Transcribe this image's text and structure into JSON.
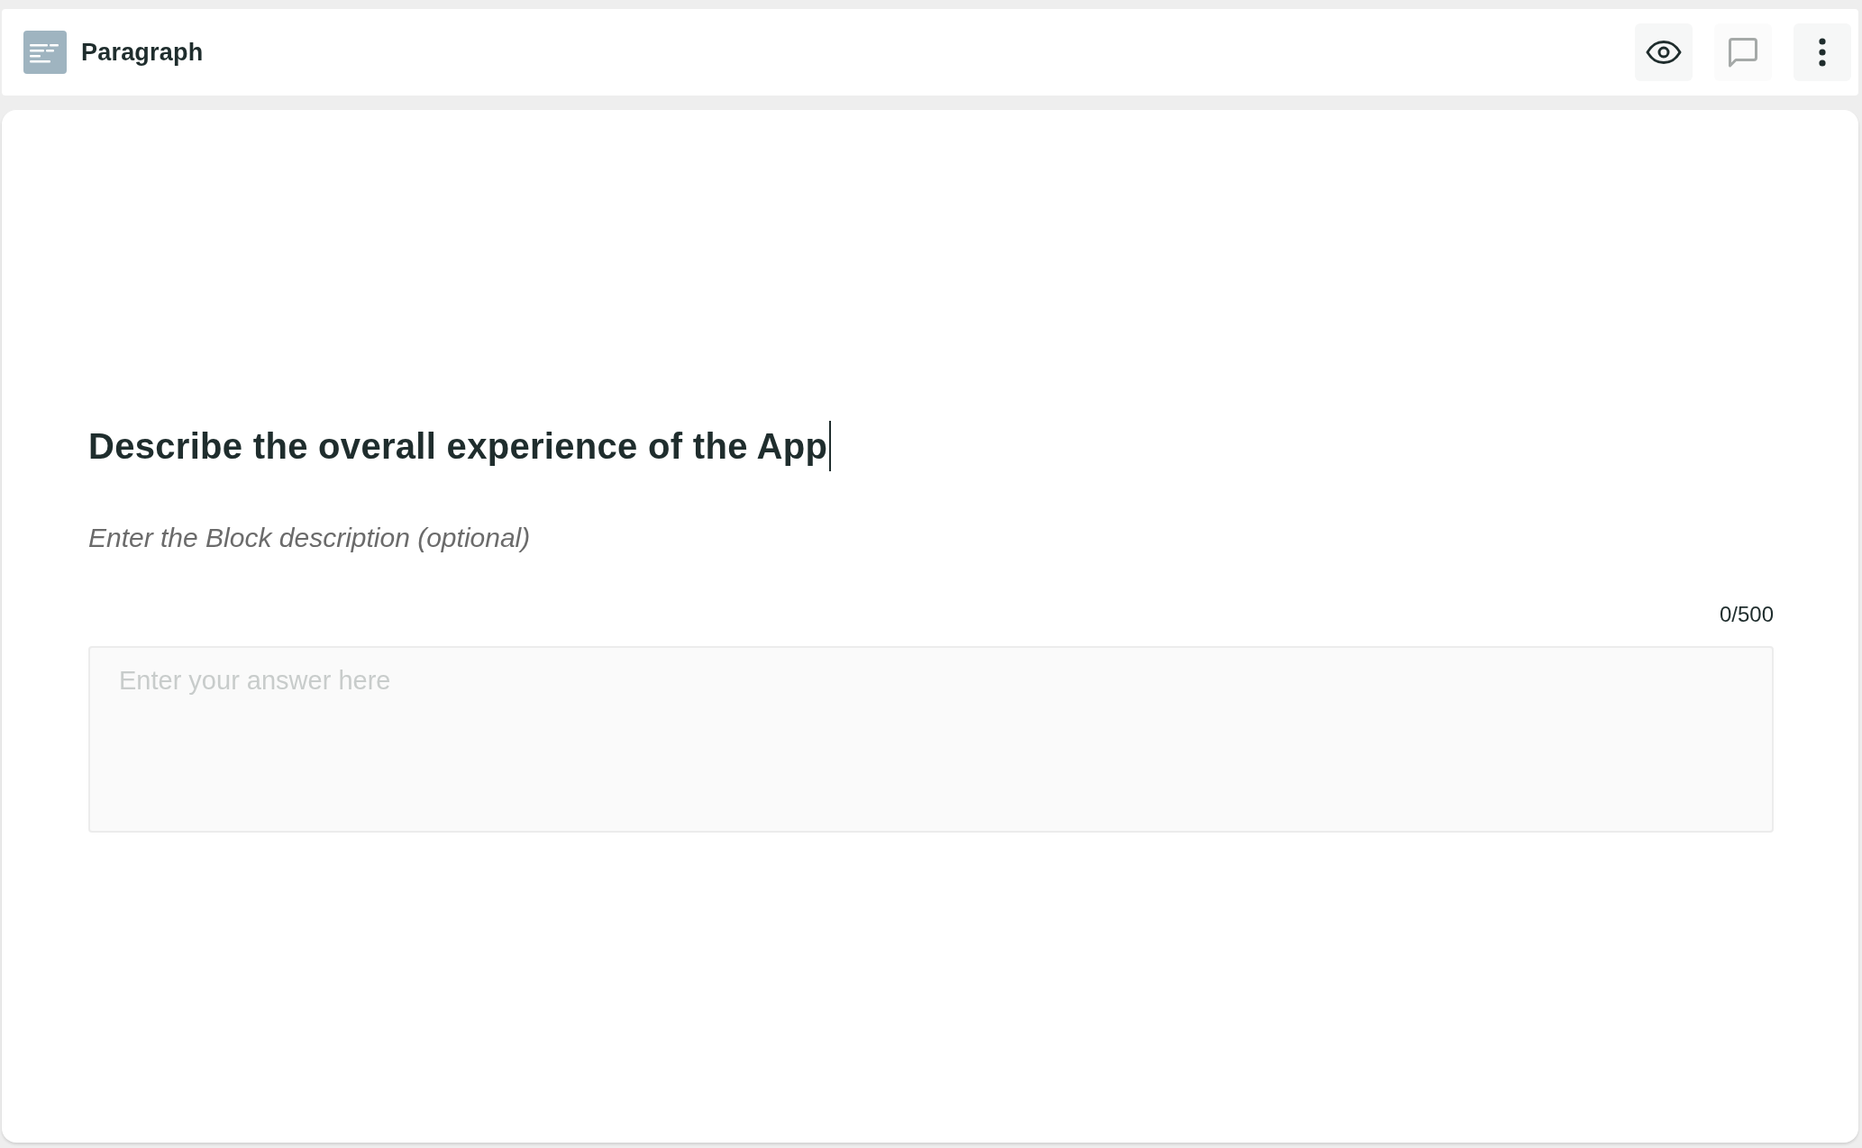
{
  "header": {
    "title": "Paragraph",
    "actions": [
      {
        "kind": "preview",
        "disabled": false
      },
      {
        "kind": "comment",
        "disabled": true
      },
      {
        "kind": "menu",
        "disabled": false
      }
    ]
  },
  "question": {
    "title": "Describe the overall experience of the App",
    "focused": true,
    "description_placeholder": "Enter the Block description (optional)"
  },
  "answer": {
    "counter": "0/500",
    "placeholder": "Enter your answer here"
  }
}
